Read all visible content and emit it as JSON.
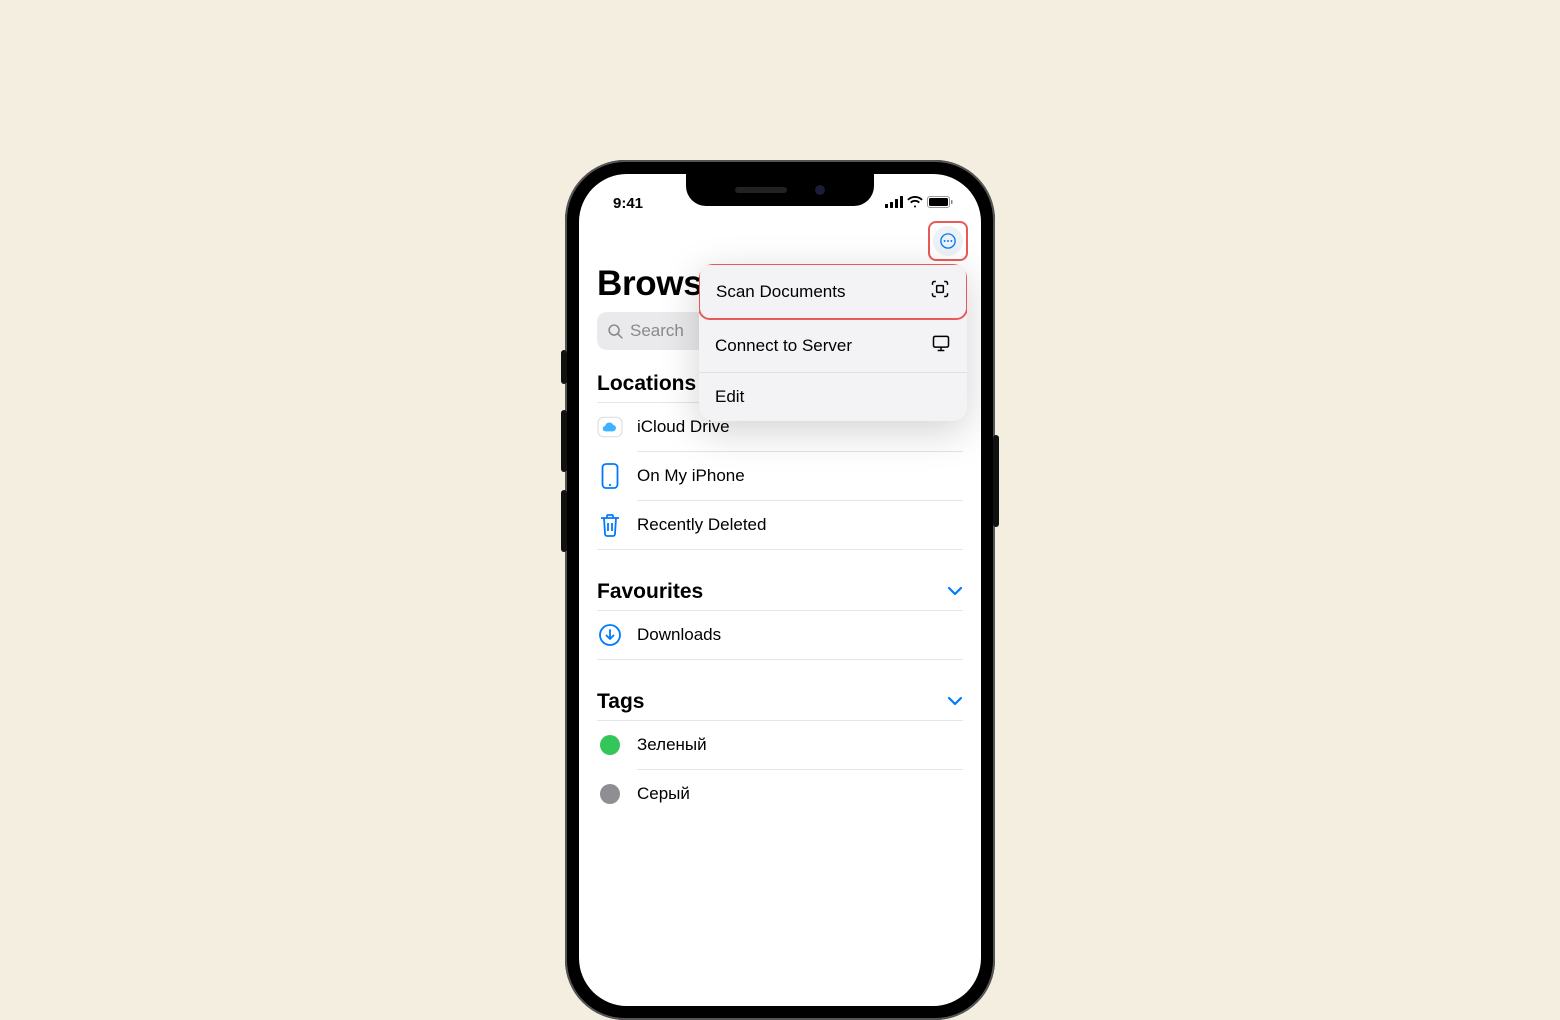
{
  "status": {
    "time": "9:41"
  },
  "page_title": "Browse",
  "search": {
    "placeholder": "Search"
  },
  "popover": {
    "items": [
      {
        "label": "Scan Documents",
        "icon": "scan-icon",
        "highlighted": true
      },
      {
        "label": "Connect to Server",
        "icon": "display-icon",
        "highlighted": false
      },
      {
        "label": "Edit",
        "icon": "",
        "highlighted": false
      }
    ]
  },
  "sections": {
    "locations": {
      "header": "Locations",
      "items": [
        {
          "label": "iCloud Drive",
          "icon": "cloud-icon"
        },
        {
          "label": "On My iPhone",
          "icon": "iphone-icon"
        },
        {
          "label": "Recently Deleted",
          "icon": "trash-icon"
        }
      ]
    },
    "favourites": {
      "header": "Favourites",
      "items": [
        {
          "label": "Downloads",
          "icon": "download-icon"
        }
      ]
    },
    "tags": {
      "header": "Tags",
      "items": [
        {
          "label": "Зеленый",
          "color": "#33c759"
        },
        {
          "label": "Серый",
          "color": "#8e8e93"
        }
      ]
    }
  }
}
